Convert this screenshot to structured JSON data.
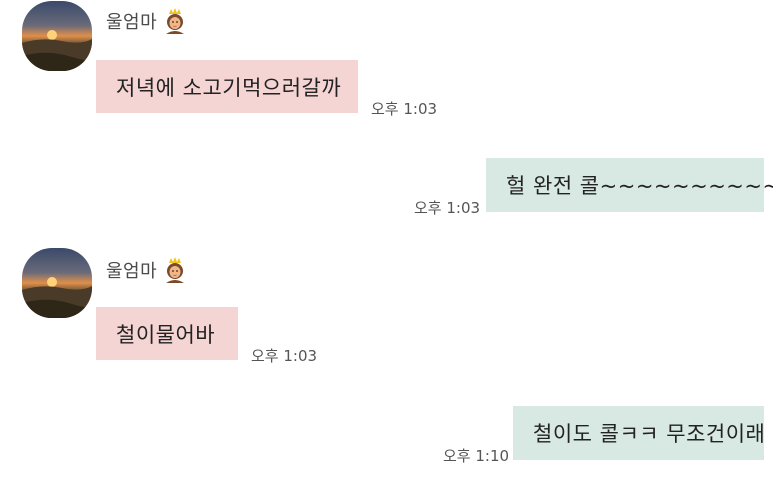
{
  "colors": {
    "incoming_bubble": "#f5d4d4",
    "outgoing_bubble": "#d8e8e2",
    "background": "#ffffff",
    "text": "#222222",
    "time_text": "#555555"
  },
  "messages": [
    {
      "direction": "incoming",
      "sender": {
        "name": "울엄마",
        "icon": "princess-emoji-icon",
        "avatar": "sunset-avatar"
      },
      "text": "저녁에 소고기먹으러갈까",
      "time": "오후 1:03"
    },
    {
      "direction": "outgoing",
      "text": "헐 완전 콜~~~~~~~~~~",
      "time": "오후 1:03"
    },
    {
      "direction": "incoming",
      "sender": {
        "name": "울엄마",
        "icon": "princess-emoji-icon",
        "avatar": "sunset-avatar"
      },
      "text": "철이물어바",
      "time": "오후 1:03"
    },
    {
      "direction": "outgoing",
      "text": "철이도 콜ㅋㅋ 무조건이래",
      "time": "오후 1:10"
    }
  ]
}
